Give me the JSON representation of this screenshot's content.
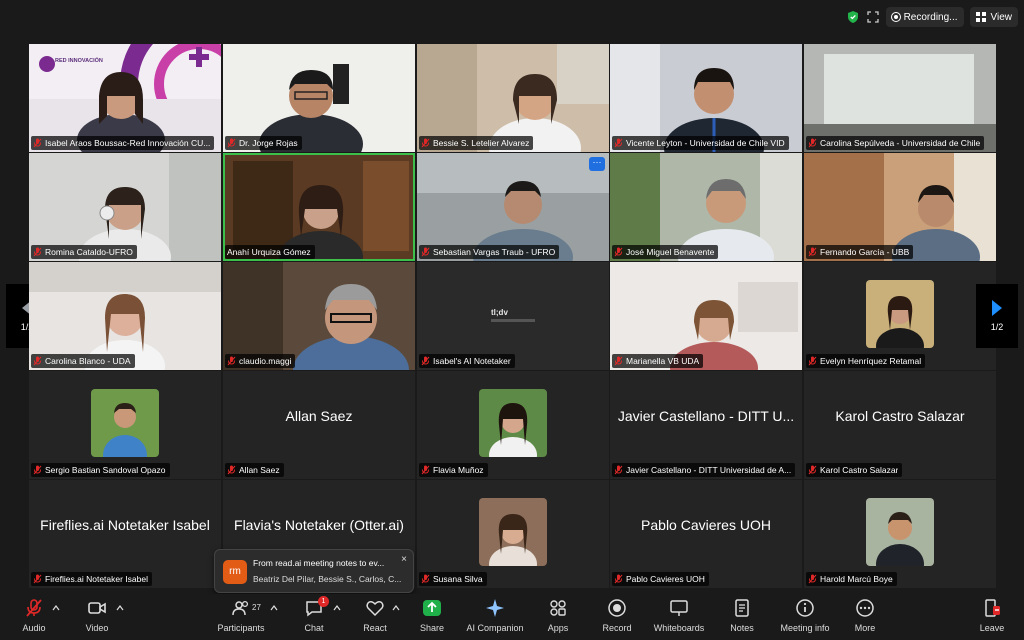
{
  "topbar": {
    "recording_label": "Recording...",
    "view_label": "View"
  },
  "gallery": {
    "page_indicator": "1/2",
    "tiles": [
      {
        "name": "Isabel Araos Boussac-Red Innovación CU...",
        "muted": true,
        "kind": "video",
        "logo_text": "RED INNOVACIÓN"
      },
      {
        "name": "Dr. Jorge Rojas",
        "muted": true,
        "kind": "video"
      },
      {
        "name": "Bessie S. Letelier Alvarez",
        "muted": true,
        "kind": "video"
      },
      {
        "name": "Vicente Leyton - Universidad de Chile VID",
        "muted": true,
        "kind": "video"
      },
      {
        "name": "Carolina Sepúlveda - Universidad de Chile",
        "muted": true,
        "kind": "video"
      },
      {
        "name": "Romina Cataldo-UFRO",
        "muted": true,
        "kind": "video"
      },
      {
        "name": "Anahí Urquiza Gómez",
        "muted": false,
        "kind": "video",
        "active": true
      },
      {
        "name": "Sebastian Vargas Traub - UFRO",
        "muted": true,
        "kind": "video"
      },
      {
        "name": "José Miguel Benavente",
        "muted": true,
        "kind": "video"
      },
      {
        "name": "Fernando García - UBB",
        "muted": true,
        "kind": "video"
      },
      {
        "name": "Carolina Blanco - UDA",
        "muted": true,
        "kind": "video"
      },
      {
        "name": "claudio.maggi",
        "muted": true,
        "kind": "video"
      },
      {
        "name": "Isabel's AI Notetaker",
        "muted": true,
        "kind": "video",
        "logo_text": "tl;dv"
      },
      {
        "name": "Marianella VB UDA",
        "muted": true,
        "kind": "video"
      },
      {
        "name": "Evelyn Henríquez Retamal",
        "muted": true,
        "kind": "avatar"
      },
      {
        "name": "Sergio Bastian Sandoval Opazo",
        "muted": true,
        "kind": "avatar"
      },
      {
        "name": "Allan Saez",
        "muted": true,
        "kind": "name",
        "big_name": "Allan Saez"
      },
      {
        "name": "Flavia Muñoz",
        "muted": true,
        "kind": "avatar"
      },
      {
        "name": "Javier Castellano - DITT Universidad de A...",
        "muted": true,
        "kind": "name",
        "big_name": "Javier Castellano - DITT U..."
      },
      {
        "name": "Karol Castro Salazar",
        "muted": true,
        "kind": "name",
        "big_name": "Karol Castro Salazar"
      },
      {
        "name": "Fireflies.ai Notetaker Isabel",
        "muted": true,
        "kind": "name",
        "big_name": "Fireflies.ai Notetaker Isabel"
      },
      {
        "name": "",
        "muted": false,
        "kind": "name",
        "big_name": "Flavia's Notetaker (Otter.ai)"
      },
      {
        "name": "Susana Silva",
        "muted": true,
        "kind": "avatar"
      },
      {
        "name": "Pablo Cavieres UOH",
        "muted": true,
        "kind": "name",
        "big_name": "Pablo Cavieres UOH"
      },
      {
        "name": "Harold Marcú Boye",
        "muted": true,
        "kind": "avatar"
      }
    ]
  },
  "toast": {
    "icon_text": "rm",
    "line1": "From read.ai meeting notes to ev...",
    "line2": "Beatriz Del Pilar, Bessie S., Carlos, C...",
    "close": "×"
  },
  "toolbar": {
    "audio": "Audio",
    "video": "Video",
    "participants": "Participants",
    "participants_count": "27",
    "chat": "Chat",
    "chat_badge": "1",
    "react": "React",
    "share": "Share",
    "ai_companion": "AI Companion",
    "apps": "Apps",
    "record": "Record",
    "whiteboards": "Whiteboards",
    "notes": "Notes",
    "meeting_info": "Meeting info",
    "more": "More",
    "leave": "Leave"
  },
  "colors": {
    "share_green": "#20b04a",
    "active_speaker": "#3cc04b",
    "leave_red": "#e02828",
    "muted_red": "#e02828",
    "toast_brand": "#e25c16"
  }
}
